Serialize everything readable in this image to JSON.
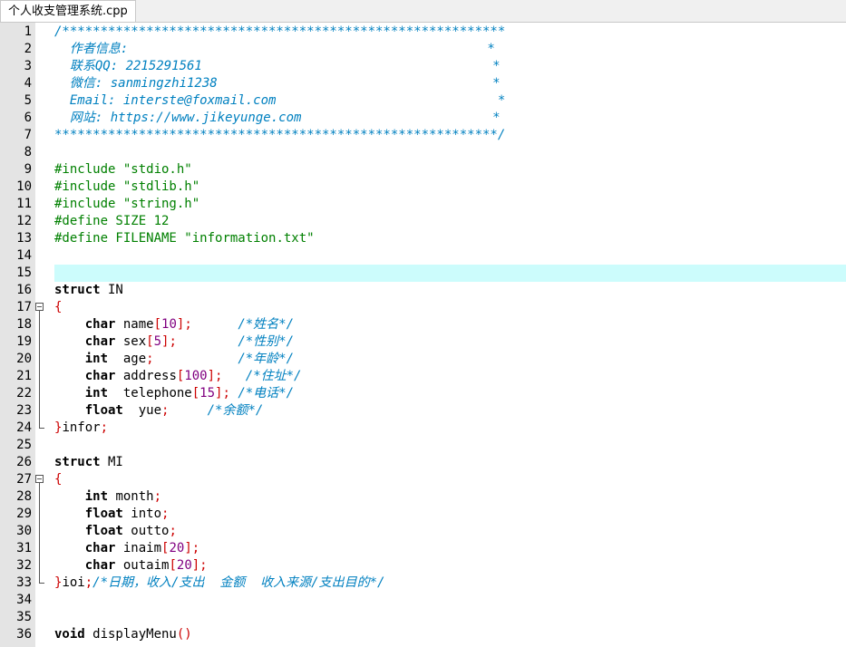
{
  "window": {
    "tab_title": "个人收支管理系统.cpp"
  },
  "editor": {
    "highlight_line": 15,
    "line_numbers": [
      "1",
      "2",
      "3",
      "4",
      "5",
      "6",
      "7",
      "8",
      "9",
      "10",
      "11",
      "12",
      "13",
      "14",
      "15",
      "16",
      "17",
      "18",
      "19",
      "20",
      "21",
      "22",
      "23",
      "24",
      "25",
      "26",
      "27",
      "28",
      "29",
      "30",
      "31",
      "32",
      "33",
      "34",
      "35",
      "36"
    ],
    "fold_markers": {
      "17": "start",
      "24": "end",
      "27": "start",
      "33": "end"
    },
    "lines": [
      [
        [
          "comment",
          "/**********************************************************"
        ]
      ],
      [
        [
          "comment",
          "  作者信息:                                               *"
        ]
      ],
      [
        [
          "comment",
          "  联系QQ: 2215291561                                      *"
        ]
      ],
      [
        [
          "comment",
          "  微信: sanmingzhi1238                                    *"
        ]
      ],
      [
        [
          "comment",
          "  Email: interste@foxmail.com                             *"
        ]
      ],
      [
        [
          "comment",
          "  网站: https://www.jikeyunge.com                         *"
        ]
      ],
      [
        [
          "comment",
          "**********************************************************/"
        ]
      ],
      [],
      [
        [
          "pre",
          "#include "
        ],
        [
          "str",
          "\"stdio.h\""
        ]
      ],
      [
        [
          "pre",
          "#include "
        ],
        [
          "str",
          "\"stdlib.h\""
        ]
      ],
      [
        [
          "pre",
          "#include "
        ],
        [
          "str",
          "\"string.h\""
        ]
      ],
      [
        [
          "pre",
          "#define SIZE 12"
        ]
      ],
      [
        [
          "pre",
          "#define FILENAME "
        ],
        [
          "str",
          "\"information.txt\""
        ]
      ],
      [],
      [],
      [
        [
          "kw",
          "struct"
        ],
        [
          "plain",
          " IN"
        ]
      ],
      [
        [
          "br",
          "{"
        ]
      ],
      [
        [
          "plain",
          "    "
        ],
        [
          "kw",
          "char"
        ],
        [
          "plain",
          " name"
        ],
        [
          "op",
          "["
        ],
        [
          "num",
          "10"
        ],
        [
          "op",
          "];"
        ],
        [
          "plain",
          "      "
        ],
        [
          "comment",
          "/*姓名*/"
        ]
      ],
      [
        [
          "plain",
          "    "
        ],
        [
          "kw",
          "char"
        ],
        [
          "plain",
          " sex"
        ],
        [
          "op",
          "["
        ],
        [
          "num",
          "5"
        ],
        [
          "op",
          "];"
        ],
        [
          "plain",
          "        "
        ],
        [
          "comment",
          "/*性别*/"
        ]
      ],
      [
        [
          "plain",
          "    "
        ],
        [
          "kw",
          "int"
        ],
        [
          "plain",
          "  age"
        ],
        [
          "op",
          ";"
        ],
        [
          "plain",
          "           "
        ],
        [
          "comment",
          "/*年龄*/"
        ]
      ],
      [
        [
          "plain",
          "    "
        ],
        [
          "kw",
          "char"
        ],
        [
          "plain",
          " address"
        ],
        [
          "op",
          "["
        ],
        [
          "num",
          "100"
        ],
        [
          "op",
          "];"
        ],
        [
          "plain",
          "   "
        ],
        [
          "comment",
          "/*住址*/"
        ]
      ],
      [
        [
          "plain",
          "    "
        ],
        [
          "kw",
          "int"
        ],
        [
          "plain",
          "  telephone"
        ],
        [
          "op",
          "["
        ],
        [
          "num",
          "15"
        ],
        [
          "op",
          "];"
        ],
        [
          "plain",
          " "
        ],
        [
          "comment",
          "/*电话*/"
        ]
      ],
      [
        [
          "plain",
          "    "
        ],
        [
          "kw",
          "float"
        ],
        [
          "plain",
          "  yue"
        ],
        [
          "op",
          ";"
        ],
        [
          "plain",
          "     "
        ],
        [
          "comment",
          "/*余额*/"
        ]
      ],
      [
        [
          "br",
          "}"
        ],
        [
          "plain",
          "infor"
        ],
        [
          "op",
          ";"
        ]
      ],
      [],
      [
        [
          "kw",
          "struct"
        ],
        [
          "plain",
          " MI"
        ]
      ],
      [
        [
          "br",
          "{"
        ]
      ],
      [
        [
          "plain",
          "    "
        ],
        [
          "kw",
          "int"
        ],
        [
          "plain",
          " month"
        ],
        [
          "op",
          ";"
        ]
      ],
      [
        [
          "plain",
          "    "
        ],
        [
          "kw",
          "float"
        ],
        [
          "plain",
          " into"
        ],
        [
          "op",
          ";"
        ]
      ],
      [
        [
          "plain",
          "    "
        ],
        [
          "kw",
          "float"
        ],
        [
          "plain",
          " outto"
        ],
        [
          "op",
          ";"
        ]
      ],
      [
        [
          "plain",
          "    "
        ],
        [
          "kw",
          "char"
        ],
        [
          "plain",
          " inaim"
        ],
        [
          "op",
          "["
        ],
        [
          "num",
          "20"
        ],
        [
          "op",
          "];"
        ]
      ],
      [
        [
          "plain",
          "    "
        ],
        [
          "kw",
          "char"
        ],
        [
          "plain",
          " outaim"
        ],
        [
          "op",
          "["
        ],
        [
          "num",
          "20"
        ],
        [
          "op",
          "];"
        ]
      ],
      [
        [
          "br",
          "}"
        ],
        [
          "plain",
          "ioi"
        ],
        [
          "op",
          ";"
        ],
        [
          "comment",
          "/*日期，收入/支出  金额  收入来源/支出目的*/"
        ]
      ],
      [],
      [],
      [
        [
          "kw",
          "void"
        ],
        [
          "plain",
          " displayMenu"
        ],
        [
          "br",
          "()"
        ]
      ]
    ]
  }
}
